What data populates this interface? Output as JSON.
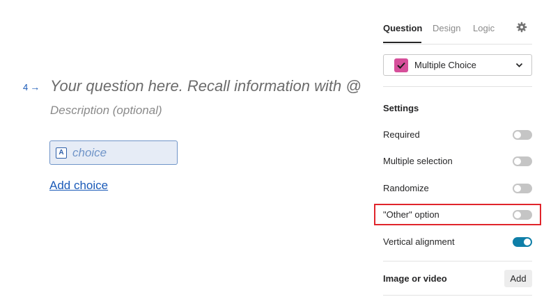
{
  "question": {
    "number": "4",
    "title_placeholder": "Your question here. Recall information with @",
    "description_placeholder": "Description (optional)",
    "choices": [
      {
        "key": "A",
        "placeholder": "choice"
      }
    ],
    "add_choice_label": "Add choice"
  },
  "panel": {
    "tabs": [
      {
        "label": "Question",
        "active": true
      },
      {
        "label": "Design",
        "active": false
      },
      {
        "label": "Logic",
        "active": false
      }
    ],
    "question_type": {
      "label": "Multiple Choice",
      "icon_color": "#d64f9a"
    },
    "settings_title": "Settings",
    "settings": [
      {
        "label": "Required",
        "on": false
      },
      {
        "label": "Multiple selection",
        "on": false
      },
      {
        "label": "Randomize",
        "on": false
      },
      {
        "label": "\"Other\" option",
        "on": false,
        "highlighted": true
      },
      {
        "label": "Vertical alignment",
        "on": true
      }
    ],
    "media": {
      "label": "Image or video",
      "button": "Add"
    }
  },
  "colors": {
    "accent_blue": "#1a5ab8",
    "toggle_on": "#0f7fa8",
    "toggle_off": "#c5c5c5",
    "highlight_red": "#e0242b"
  }
}
